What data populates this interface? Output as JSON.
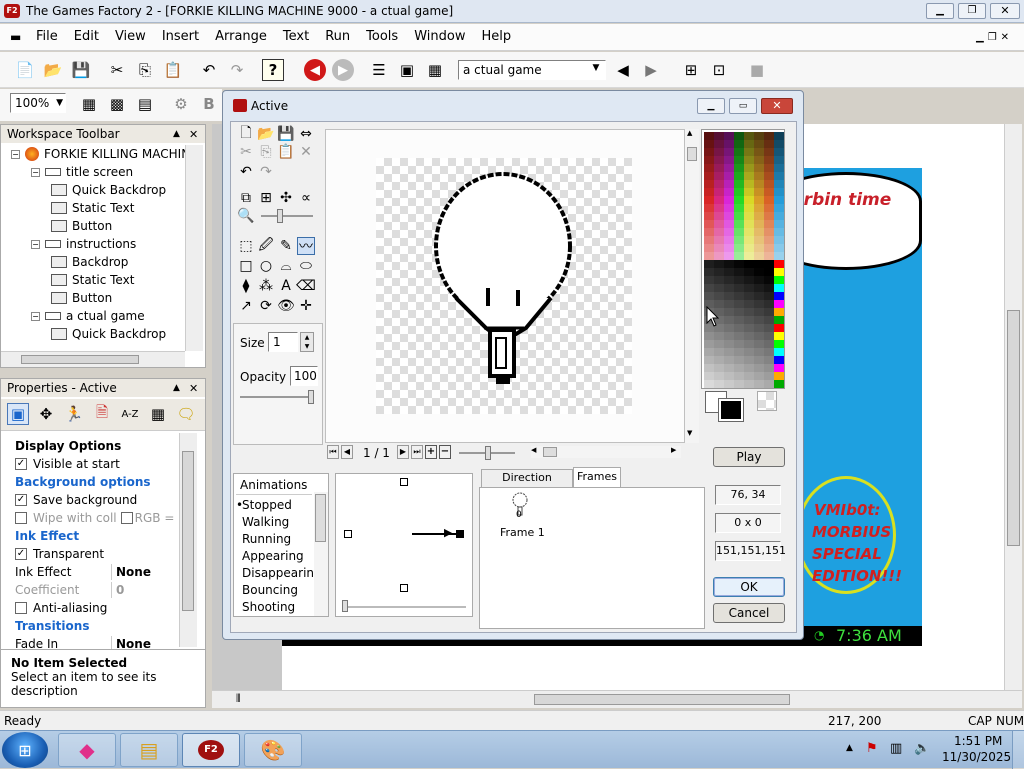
{
  "window": {
    "title": "The Games Factory 2 - [FORKIE KILLING MACHINE 9000 - a ctual game]"
  },
  "menu": [
    "File",
    "Edit",
    "View",
    "Insert",
    "Arrange",
    "Text",
    "Run",
    "Tools",
    "Window",
    "Help"
  ],
  "toolbar": {
    "frame_select": "a ctual game",
    "zoom": "100%"
  },
  "workspace": {
    "title": "Workspace Toolbar",
    "items": [
      {
        "label": "FORKIE KILLING MACHINE",
        "level": 0
      },
      {
        "label": "title screen",
        "level": 1
      },
      {
        "label": "Quick Backdrop",
        "level": 2
      },
      {
        "label": "Static Text",
        "level": 2
      },
      {
        "label": "Button",
        "level": 2
      },
      {
        "label": "instructions",
        "level": 1
      },
      {
        "label": "Backdrop",
        "level": 2
      },
      {
        "label": "Static Text",
        "level": 2
      },
      {
        "label": "Button",
        "level": 2
      },
      {
        "label": "a ctual game",
        "level": 1
      },
      {
        "label": "Quick Backdrop",
        "level": 2
      }
    ]
  },
  "properties": {
    "title": "Properties - Active",
    "rows": [
      {
        "type": "header",
        "label": "Display Options"
      },
      {
        "type": "check",
        "label": "Visible at start",
        "checked": true
      },
      {
        "type": "section",
        "label": "Background options"
      },
      {
        "type": "check",
        "label": "Save background",
        "checked": true
      },
      {
        "type": "check-dim",
        "label": "Wipe with coll",
        "value": "RGB =",
        "checked": false
      },
      {
        "type": "section",
        "label": "Ink Effect"
      },
      {
        "type": "check",
        "label": "Transparent",
        "checked": true
      },
      {
        "type": "kv",
        "label": "Ink Effect",
        "value": "None"
      },
      {
        "type": "kv-dim",
        "label": "Coefficient",
        "value": "0"
      },
      {
        "type": "check",
        "label": "Anti-aliasing",
        "checked": false
      },
      {
        "type": "section",
        "label": "Transitions"
      },
      {
        "type": "kv",
        "label": "Fade In",
        "value": "None"
      }
    ],
    "footer_title": "No Item Selected",
    "footer_desc": "Select an item to see its description"
  },
  "editor": {
    "title": "Active",
    "size_label": "Size",
    "size_value": "1",
    "opacity_label": "Opacity",
    "opacity_value": "100",
    "frame_counter": "1 / 1",
    "animations_header": "Animations",
    "animations": [
      "Stopped",
      "Walking",
      "Running",
      "Appearing",
      "Disappearing",
      "Bouncing",
      "Shooting"
    ],
    "tabs": [
      "Direction Options",
      "Frames"
    ],
    "frame_label": "Frame 1",
    "frame_number": "0",
    "coords": "76, 34",
    "size_readout": "0 x 0",
    "color_readout": "151,151,151",
    "play": "Play",
    "ok": "OK",
    "cancel": "Cancel"
  },
  "game_preview": {
    "text1": "orbin time",
    "text2": "VMIb0t:",
    "text3": "MORBIUS",
    "text4": "SPECIAL",
    "text5": "EDITION!!!",
    "clock": "7:36 AM"
  },
  "status": {
    "left": "Ready",
    "coords": "217, 200",
    "cap": "CAP",
    "num": "NUM"
  },
  "taskbar": {
    "time": "1:51 PM",
    "date": "11/30/2025"
  },
  "colors": {
    "title_bg": "#d6e4f5",
    "accent_blue": "#1a66cc",
    "canvas_blue": "#1ea0e0"
  }
}
